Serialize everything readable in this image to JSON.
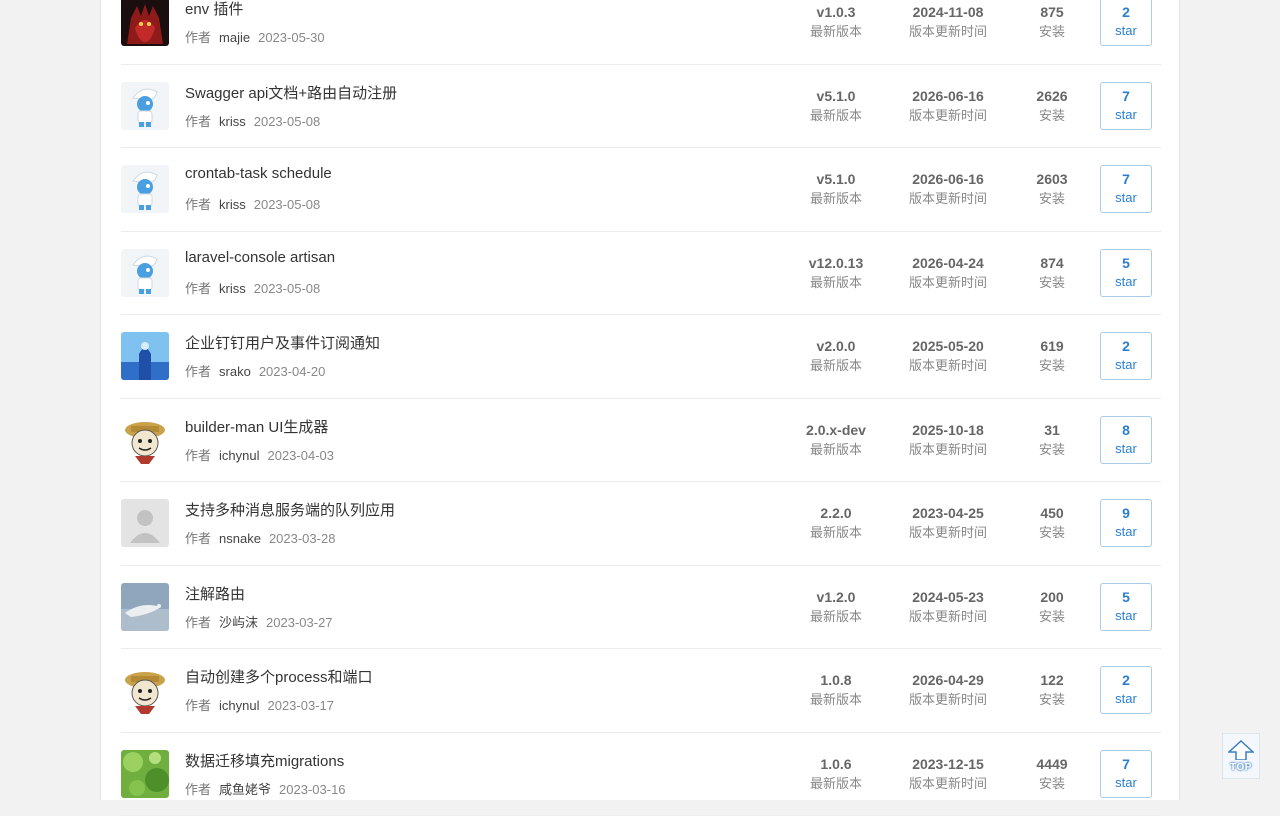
{
  "labels": {
    "author_label": "作者",
    "version_label": "最新版本",
    "updated_label": "版本更新时间",
    "installs_label": "安装",
    "star_label": "star"
  },
  "back_to_top": {
    "text": "TOP"
  },
  "plugins": [
    {
      "title": "env 插件",
      "author": "majie",
      "date": "2023-05-30",
      "version": "v1.0.3",
      "updated": "2024-11-08",
      "installs": "875",
      "stars": "2",
      "avatar_icon": "red-monster-avatar"
    },
    {
      "title": "Swagger api文档+路由自动注册",
      "author": "kriss",
      "date": "2023-05-08",
      "version": "v5.1.0",
      "updated": "2026-06-16",
      "installs": "2626",
      "stars": "7",
      "avatar_icon": "smurf-avatar"
    },
    {
      "title": "crontab-task schedule",
      "author": "kriss",
      "date": "2023-05-08",
      "version": "v5.1.0",
      "updated": "2026-06-16",
      "installs": "2603",
      "stars": "7",
      "avatar_icon": "smurf-avatar"
    },
    {
      "title": "laravel-console artisan",
      "author": "kriss",
      "date": "2023-05-08",
      "version": "v12.0.13",
      "updated": "2026-04-24",
      "installs": "874",
      "stars": "5",
      "avatar_icon": "smurf-avatar"
    },
    {
      "title": "企业钉钉用户及事件订阅通知",
      "author": "srako",
      "date": "2023-04-20",
      "version": "v2.0.0",
      "updated": "2025-05-20",
      "installs": "619",
      "stars": "2",
      "avatar_icon": "blue-photo-avatar"
    },
    {
      "title": "builder-man UI生成器",
      "author": "ichynul",
      "date": "2023-04-03",
      "version": "2.0.x-dev",
      "updated": "2025-10-18",
      "installs": "31",
      "stars": "8",
      "avatar_icon": "meme-face-avatar"
    },
    {
      "title": "支持多种消息服务端的队列应用",
      "author": "nsnake",
      "date": "2023-03-28",
      "version": "2.2.0",
      "updated": "2023-04-25",
      "installs": "450",
      "stars": "9",
      "avatar_icon": "default-user-avatar"
    },
    {
      "title": "注解路由",
      "author": "沙屿沫",
      "date": "2023-03-27",
      "version": "v1.2.0",
      "updated": "2024-05-23",
      "installs": "200",
      "stars": "5",
      "avatar_icon": "bird-photo-avatar"
    },
    {
      "title": "自动创建多个process和端口",
      "author": "ichynul",
      "date": "2023-03-17",
      "version": "1.0.8",
      "updated": "2026-04-29",
      "installs": "122",
      "stars": "2",
      "avatar_icon": "meme-face-avatar"
    },
    {
      "title": "数据迁移填充migrations",
      "author": "咸鱼姥爷",
      "date": "2023-03-16",
      "version": "1.0.6",
      "updated": "2023-12-15",
      "installs": "4449",
      "stars": "7",
      "avatar_icon": "green-leaf-avatar"
    }
  ]
}
